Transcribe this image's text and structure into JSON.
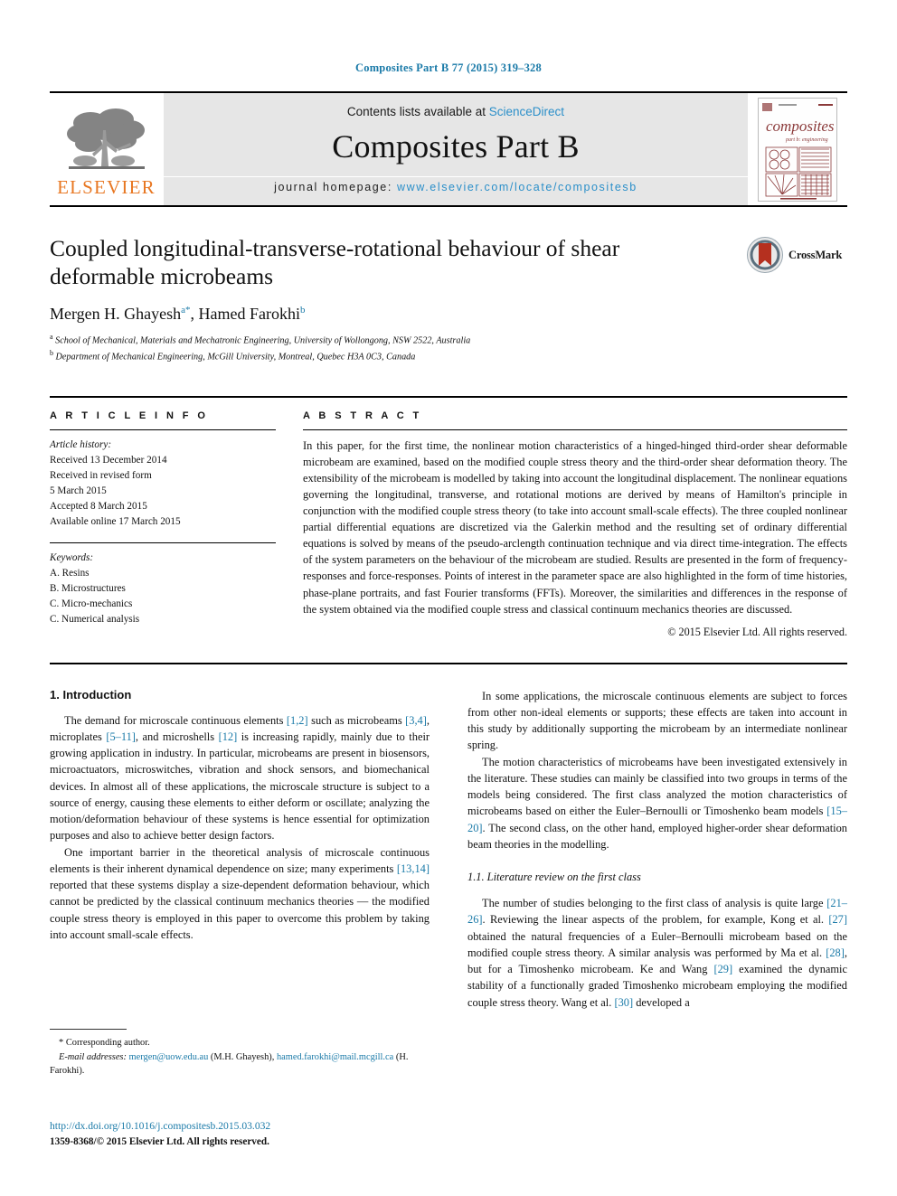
{
  "running_head": "Composites Part B 77 (2015) 319–328",
  "masthead": {
    "publisher_name": "ELSEVIER",
    "contents_prefix": "Contents lists available at",
    "contents_link": "ScienceDirect",
    "journal_title": "Composites Part B",
    "homepage_prefix": "journal homepage:",
    "homepage_url": "www.elsevier.com/locate/compositesb",
    "cover_word": "composites",
    "cover_subtitle": "part b: engineering"
  },
  "article": {
    "title": "Coupled longitudinal-transverse-rotational behaviour of shear deformable microbeams",
    "authors_1": "Mergen H. Ghayesh",
    "authors_sup_1": "a",
    "authors_corresponding_mark": "*",
    "authors_2": "Hamed Farokhi",
    "authors_sup_2": "b",
    "affiliation_a_sup": "a",
    "affiliation_a": "School of Mechanical, Materials and Mechatronic Engineering, University of Wollongong, NSW 2522, Australia",
    "affiliation_b_sup": "b",
    "affiliation_b": "Department of Mechanical Engineering, McGill University, Montreal, Quebec H3A 0C3, Canada",
    "crossmark_label": "CrossMark"
  },
  "article_info": {
    "heading": "A R T I C L E    I N F O",
    "history_label": "Article history:",
    "history": [
      "Received 13 December 2014",
      "Received in revised form",
      "5 March 2015",
      "Accepted 8 March 2015",
      "Available online 17 March 2015"
    ],
    "keywords_label": "Keywords:",
    "keywords": [
      "A. Resins",
      "B. Microstructures",
      "C. Micro-mechanics",
      "C. Numerical analysis"
    ]
  },
  "abstract": {
    "heading": "A B S T R A C T",
    "text": "In this paper, for the first time, the nonlinear motion characteristics of a hinged-hinged third-order shear deformable microbeam are examined, based on the modified couple stress theory and the third-order shear deformation theory. The extensibility of the microbeam is modelled by taking into account the longitudinal displacement. The nonlinear equations governing the longitudinal, transverse, and rotational motions are derived by means of Hamilton's principle in conjunction with the modified couple stress theory (to take into account small-scale effects). The three coupled nonlinear partial differential equations are discretized via the Galerkin method and the resulting set of ordinary differential equations is solved by means of the pseudo-arclength continuation technique and via direct time-integration. The effects of the system parameters on the behaviour of the microbeam are studied. Results are presented in the form of frequency-responses and force-responses. Points of interest in the parameter space are also highlighted in the form of time histories, phase-plane portraits, and fast Fourier transforms (FFTs). Moreover, the similarities and differences in the response of the system obtained via the modified couple stress and classical continuum mechanics theories are discussed.",
    "copyright": "© 2015 Elsevier Ltd. All rights reserved."
  },
  "body": {
    "intro_heading": "1. Introduction",
    "left_p1_a": "The demand for microscale continuous elements ",
    "left_p1_r1": "[1,2]",
    "left_p1_b": " such as microbeams ",
    "left_p1_r2": "[3,4]",
    "left_p1_c": ", microplates ",
    "left_p1_r3": "[5–11]",
    "left_p1_d": ", and microshells ",
    "left_p1_r4": "[12]",
    "left_p1_e": " is increasing rapidly, mainly due to their growing application in industry. In particular, microbeams are present in biosensors, microactuators, microswitches, vibration and shock sensors, and biomechanical devices. In almost all of these applications, the microscale structure is subject to a source of energy, causing these elements to either deform or oscillate; analyzing the motion/deformation behaviour of these systems is hence essential for optimization purposes and also to achieve better design factors.",
    "left_p2_a": "One important barrier in the theoretical analysis of microscale continuous elements is their inherent dynamical dependence on size; many experiments ",
    "left_p2_r1": "[13,14]",
    "left_p2_b": " reported that these systems display a size-dependent deformation behaviour, which cannot be predicted by the classical continuum mechanics theories — the modified couple stress theory is employed in this paper to overcome this problem by taking into account small-scale effects.",
    "right_p1": "In some applications, the microscale continuous elements are subject to forces from other non-ideal elements or supports; these effects are taken into account in this study by additionally supporting the microbeam by an intermediate nonlinear spring.",
    "right_p2_a": "The motion characteristics of microbeams have been investigated extensively in the literature. These studies can mainly be classified into two groups in terms of the models being considered. The first class analyzed the motion characteristics of microbeams based on either the Euler–Bernoulli or Timoshenko beam models ",
    "right_p2_r1": "[15–20]",
    "right_p2_b": ". The second class, on the other hand, employed higher-order shear deformation beam theories in the modelling.",
    "sub_heading": "1.1. Literature review on the first class",
    "right_p3_a": "The number of studies belonging to the first class of analysis is quite large ",
    "right_p3_r1": "[21–26]",
    "right_p3_b": ". Reviewing the linear aspects of the problem, for example, Kong et al. ",
    "right_p3_r2": "[27]",
    "right_p3_c": " obtained the natural frequencies of a Euler–Bernoulli microbeam based on the modified couple stress theory. A similar analysis was performed by Ma et al. ",
    "right_p3_r3": "[28]",
    "right_p3_d": ", but for a Timoshenko microbeam. Ke and Wang ",
    "right_p3_r4": "[29]",
    "right_p3_e": " examined the dynamic stability of a functionally graded Timoshenko microbeam employing the modified couple stress theory. Wang et al. ",
    "right_p3_r5": "[30]",
    "right_p3_f": " developed a"
  },
  "footnotes": {
    "corresponding_mark": "*",
    "corresponding_text": "Corresponding author.",
    "email_label": "E-mail addresses:",
    "email_1": "mergen@uow.edu.au",
    "email_1_owner": "(M.H. Ghayesh),",
    "email_2": "hamed.farokhi@mail.mcgill.ca",
    "email_2_owner": "(H. Farokhi).",
    "doi": "http://dx.doi.org/10.1016/j.compositesb.2015.03.032",
    "issn": "1359-8368/© 2015 Elsevier Ltd. All rights reserved."
  },
  "colors": {
    "link": "#1a7aa8",
    "sciencedirect": "#2b8fc9",
    "elsevier_orange": "#E87722",
    "crossmark_red": "#b5301f",
    "cover_maroon": "#8b3a3a"
  }
}
